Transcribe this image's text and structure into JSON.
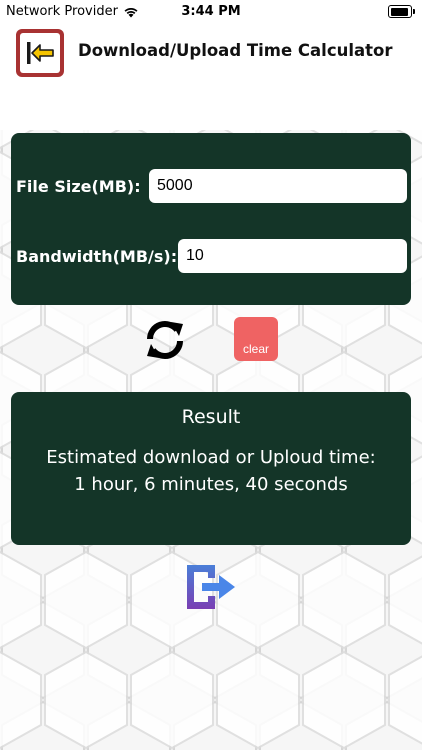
{
  "status_bar": {
    "carrier": "Network Provider",
    "time": "3:44 PM",
    "battery_level": 0.9
  },
  "header": {
    "title": "Download/Upload Time Calculator",
    "back_icon": "back-arrow-icon"
  },
  "form": {
    "file_size": {
      "label": "File Size(MB):",
      "value": "5000"
    },
    "bandwidth": {
      "label": "Bandwidth(MB/s):",
      "value": "10"
    }
  },
  "actions": {
    "refresh_icon": "refresh-icon",
    "clear_label": "clear"
  },
  "result": {
    "title": "Result",
    "line1": "Estimated download or Uploud time:",
    "line2": "1 hour, 6 minutes, 40 seconds"
  },
  "exit_icon": "exit-icon",
  "colors": {
    "panel": "#143528",
    "clear": "#ef6363",
    "back_border": "#a83232",
    "arrow": "#f5c400",
    "exit_blue": "#4a7fd8",
    "exit_purple": "#7a3fb3"
  }
}
